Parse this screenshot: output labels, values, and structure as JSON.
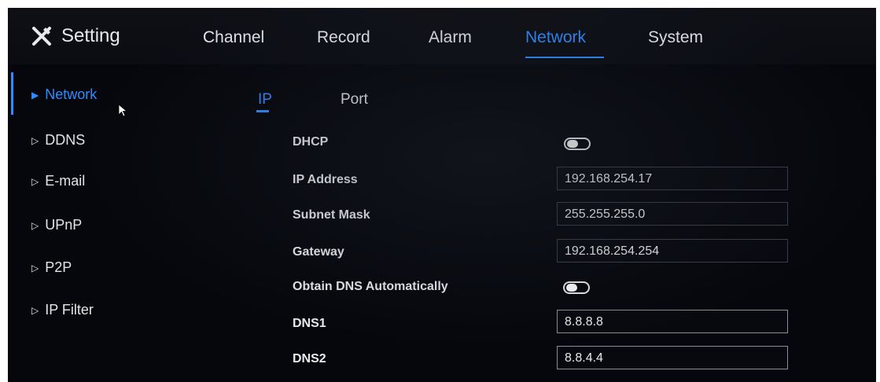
{
  "header": {
    "title": "Setting",
    "tabs": [
      {
        "label": "Channel"
      },
      {
        "label": "Record"
      },
      {
        "label": "Alarm"
      },
      {
        "label": "Network",
        "active": true
      },
      {
        "label": "System"
      }
    ]
  },
  "sidebar": {
    "items": [
      {
        "label": "Network",
        "active": true
      },
      {
        "label": "DDNS"
      },
      {
        "label": "E-mail"
      },
      {
        "label": "UPnP"
      },
      {
        "label": "P2P"
      },
      {
        "label": "IP Filter"
      }
    ]
  },
  "subtabs": [
    {
      "label": "IP",
      "active": true
    },
    {
      "label": "Port"
    }
  ],
  "form": {
    "dhcp": {
      "label": "DHCP",
      "enabled": false
    },
    "ip_address": {
      "label": "IP Address",
      "value": "192.168.254.17"
    },
    "subnet_mask": {
      "label": "Subnet Mask",
      "value": "255.255.255.0"
    },
    "gateway": {
      "label": "Gateway",
      "value": "192.168.254.254"
    },
    "obtain_dns": {
      "label": "Obtain DNS Automatically",
      "enabled": false
    },
    "dns1": {
      "label": "DNS1",
      "value": "8.8.8.8"
    },
    "dns2": {
      "label": "DNS2",
      "value": "8.8.4.4"
    }
  },
  "colors": {
    "accent": "#2f8cff",
    "background": "#05070c",
    "text": "#e6e7ec"
  },
  "icons": {
    "logo": "tools-icon",
    "sidebar_active": "triangle-right-filled-icon",
    "sidebar_inactive": "triangle-right-outline-icon",
    "pointer": "mouse-pointer-icon"
  }
}
